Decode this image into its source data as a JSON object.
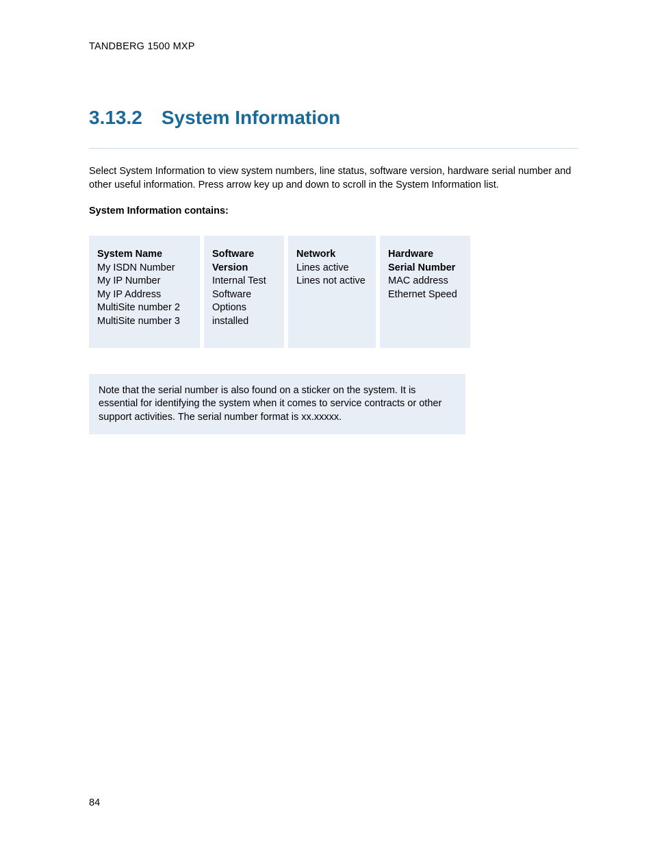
{
  "header": {
    "product": "TANDBERG 1500 MXP"
  },
  "section": {
    "number": "3.13.2",
    "title": "System Information"
  },
  "intro": "Select System Information to view system numbers, line status, software version, hardware serial number and other useful information.  Press arrow key up and down to scroll in the System Information list.",
  "contains_heading": "System Information contains:",
  "columns": [
    {
      "heading": "System Name",
      "items": [
        "My ISDN Number",
        "My IP Number",
        "My IP Address",
        "MultiSite number 2",
        "MultiSite number 3"
      ]
    },
    {
      "heading": "Software Version",
      "items": [
        "Internal Test Software",
        "Options installed"
      ]
    },
    {
      "heading": "Network",
      "items": [
        "Lines active",
        "Lines not active"
      ]
    },
    {
      "heading": "Hardware Serial Number",
      "items": [
        "MAC address",
        "Ethernet Speed"
      ]
    }
  ],
  "note": "Note that the serial number is also found on a sticker on the system. It is essential for identifying the system when it comes to service contracts or other support activities. The serial number format is xx.xxxxx.",
  "page_number": "84"
}
